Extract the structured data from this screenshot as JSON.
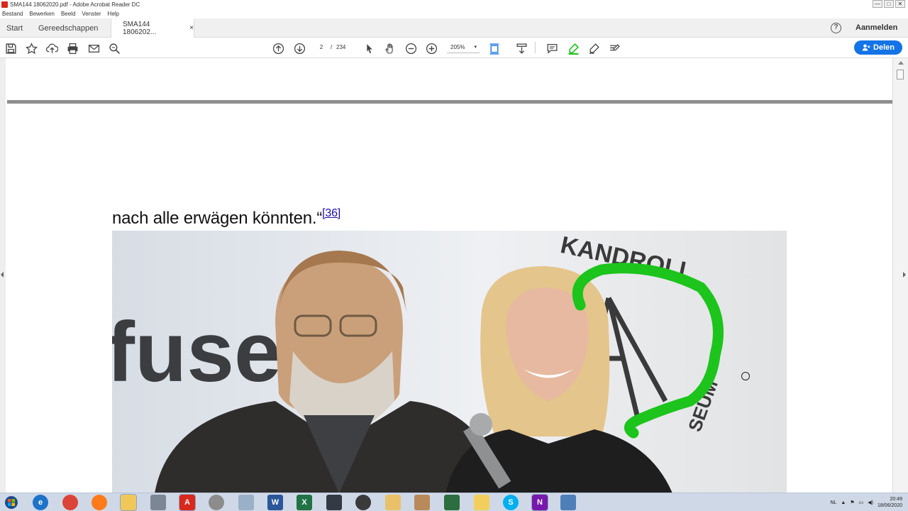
{
  "window": {
    "title": "SMA144 18062020.pdf - Adobe Acrobat Reader DC",
    "controls": [
      "—",
      "□",
      "✕"
    ]
  },
  "menu": [
    "Bestand",
    "Bewerken",
    "Beeld",
    "Venster",
    "Help"
  ],
  "tabs": {
    "start": "Start",
    "tools": "Gereedschappen",
    "document": "SMA144 1806202...",
    "close": "×"
  },
  "header_right": {
    "help": "?",
    "signin": "Aanmelden"
  },
  "toolbar": {
    "current_page": "2",
    "page_separator": "/",
    "total_pages": "234",
    "zoom": "205%",
    "zoom_caret": "▾",
    "share_label": "Delen"
  },
  "document": {
    "text": "nach alle erwägen könnten.“",
    "footnote": "[36]",
    "photo": {
      "sign_left": "fuse",
      "sign_right": "KANDROLL",
      "sign_right_bottom": "SEUM"
    }
  },
  "colors": {
    "accent": "#1473e6",
    "acrobat_red": "#d9281c",
    "highlight_green": "#1cc41c"
  },
  "taskbar": {
    "apps": [
      "edge-icon",
      "chrome-icon",
      "firefox-icon",
      "explorer-icon",
      "printer-icon",
      "acrobat-icon",
      "paint-icon",
      "inkscape-icon",
      "word-icon",
      "excel-icon",
      "audio-icon",
      "obs-icon",
      "folder-icon",
      "tool-icon",
      "terminal-icon",
      "folder2-icon",
      "skype-icon",
      "onenote-icon",
      "screen-icon"
    ],
    "lang": "NL",
    "time": "20:49",
    "date": "18/06/2020"
  }
}
